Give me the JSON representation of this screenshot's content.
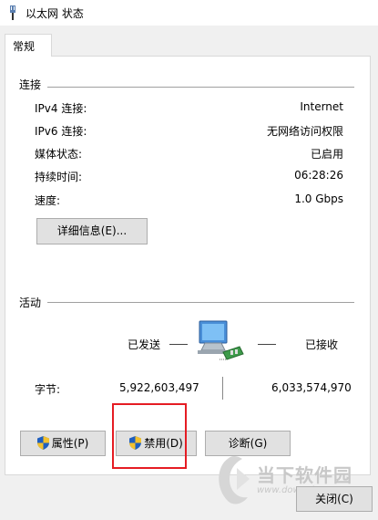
{
  "window": {
    "title": "以太网 状态",
    "icon": "network-adapter-icon"
  },
  "tabs": [
    {
      "label": "常规",
      "active": true
    }
  ],
  "connection": {
    "section_label": "连接",
    "rows": [
      {
        "label": "IPv4 连接:",
        "value": "Internet"
      },
      {
        "label": "IPv6 连接:",
        "value": "无网络访问权限"
      },
      {
        "label": "媒体状态:",
        "value": "已启用"
      },
      {
        "label": "持续时间:",
        "value": "06:28:26"
      },
      {
        "label": "速度:",
        "value": "1.0 Gbps"
      }
    ],
    "details_button": "详细信息(E)..."
  },
  "activity": {
    "section_label": "活动",
    "sent_label": "已发送",
    "received_label": "已接收",
    "bytes_label": "字节:",
    "bytes_sent": "5,922,603,497",
    "bytes_received": "6,033,574,970"
  },
  "actions": {
    "properties": "属性(P)",
    "disable": "禁用(D)",
    "diagnose": "诊断(G)"
  },
  "footer": {
    "close": "关闭(C)"
  },
  "watermark": {
    "name": "当下软件园",
    "url": "www.downxia.com"
  },
  "colors": {
    "highlight": "#e51c23",
    "button_bg": "#e1e1e1",
    "shield_blue": "#1f5fbf",
    "shield_gold": "#f2c12e"
  }
}
